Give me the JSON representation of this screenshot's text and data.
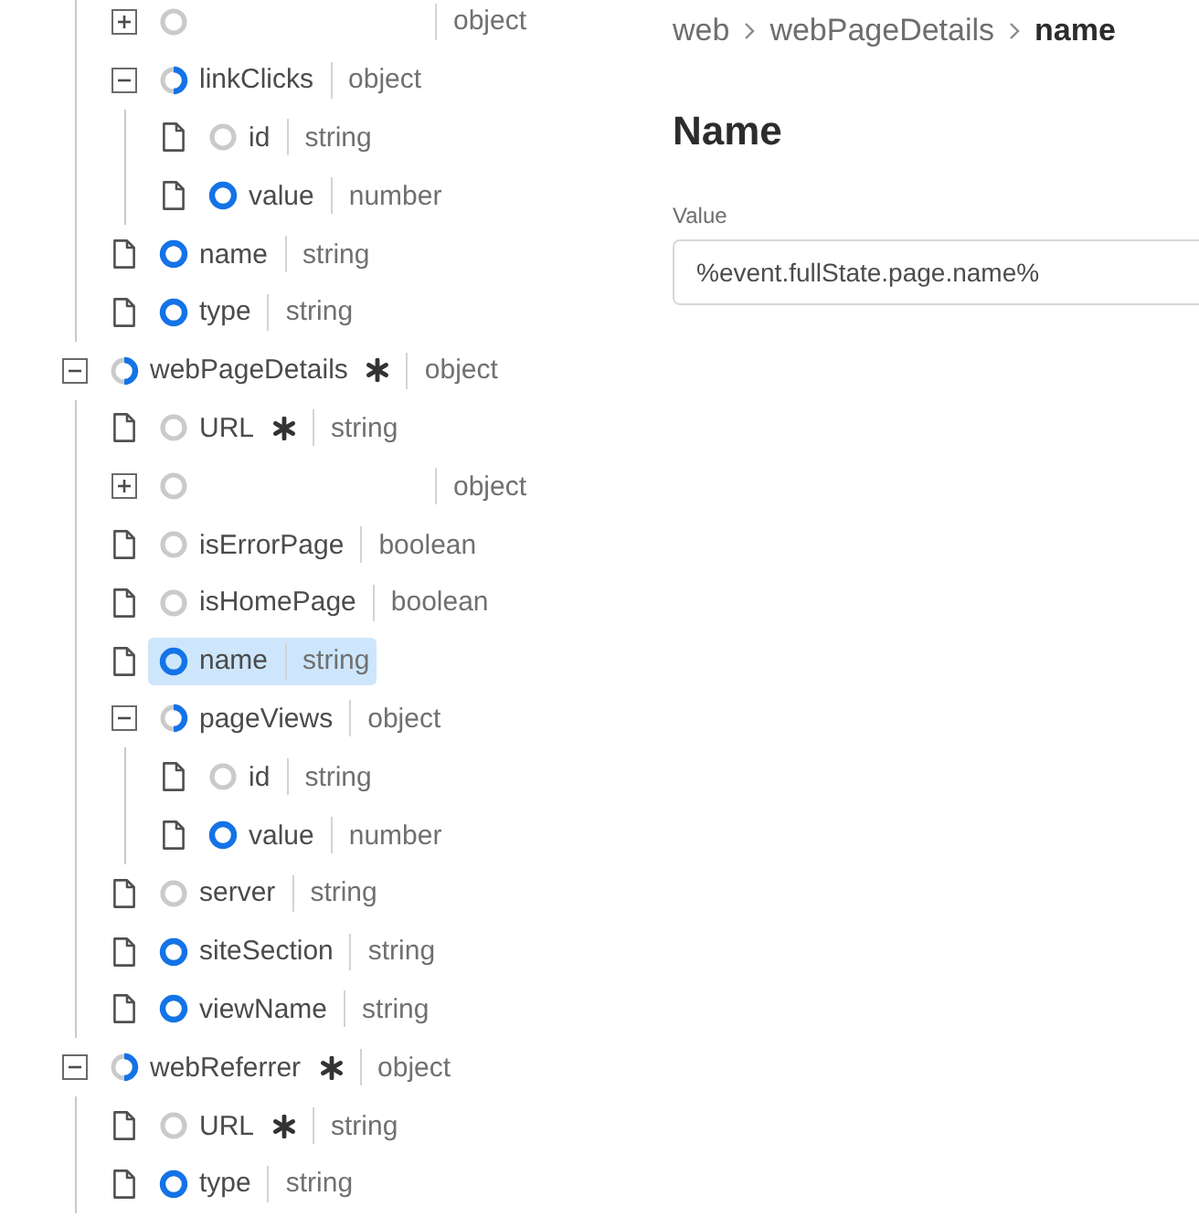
{
  "tree_top_children": [
    {
      "kind": "object",
      "mapped": false,
      "partly_mapped": false,
      "type": "object",
      "required": false,
      "expanded": false,
      "selected": false
    },
    {
      "kind": "object",
      "label": "linkClicks",
      "mapped": false,
      "partly_mapped": true,
      "type": "object",
      "required": false,
      "expanded": true,
      "selected": false,
      "children": [
        {
          "kind": "leaf",
          "label": "id",
          "mapped": false,
          "partly_mapped": false,
          "type": "string",
          "required": false,
          "selected": false
        },
        {
          "kind": "leaf",
          "label": "value",
          "mapped": true,
          "partly_mapped": false,
          "type": "number",
          "required": false,
          "selected": false
        }
      ]
    },
    {
      "kind": "leaf",
      "label": "name",
      "mapped": true,
      "partly_mapped": false,
      "type": "string",
      "required": false,
      "selected": false
    },
    {
      "kind": "leaf",
      "label": "type",
      "mapped": true,
      "partly_mapped": false,
      "type": "string",
      "required": false,
      "selected": false
    }
  ],
  "tree": [
    {
      "kind": "object",
      "label": "webPageDetails",
      "mapped": false,
      "partly_mapped": true,
      "type": "object",
      "required": true,
      "expanded": true,
      "selected": false,
      "children": [
        {
          "kind": "leaf",
          "label": "URL",
          "mapped": false,
          "partly_mapped": false,
          "type": "string",
          "required": true,
          "selected": false
        },
        {
          "kind": "object",
          "mapped": false,
          "partly_mapped": false,
          "type": "object",
          "required": false,
          "expanded": false,
          "selected": false
        },
        {
          "kind": "leaf",
          "label": "isErrorPage",
          "mapped": false,
          "partly_mapped": false,
          "type": "boolean",
          "required": false,
          "selected": false
        },
        {
          "kind": "leaf",
          "label": "isHomePage",
          "mapped": false,
          "partly_mapped": false,
          "type": "boolean",
          "required": false,
          "selected": false
        },
        {
          "kind": "leaf",
          "label": "name",
          "mapped": true,
          "partly_mapped": false,
          "type": "string",
          "required": false,
          "selected": true
        },
        {
          "kind": "object",
          "label": "pageViews",
          "mapped": false,
          "partly_mapped": true,
          "type": "object",
          "required": false,
          "expanded": true,
          "selected": false,
          "children": [
            {
              "kind": "leaf",
              "label": "id",
              "mapped": false,
              "partly_mapped": false,
              "type": "string",
              "required": false,
              "selected": false
            },
            {
              "kind": "leaf",
              "label": "value",
              "mapped": true,
              "partly_mapped": false,
              "type": "number",
              "required": false,
              "selected": false
            }
          ]
        },
        {
          "kind": "leaf",
          "label": "server",
          "mapped": false,
          "partly_mapped": false,
          "type": "string",
          "required": false,
          "selected": false
        },
        {
          "kind": "leaf",
          "label": "siteSection",
          "mapped": true,
          "partly_mapped": false,
          "type": "string",
          "required": false,
          "selected": false
        },
        {
          "kind": "leaf",
          "label": "viewName",
          "mapped": true,
          "partly_mapped": false,
          "type": "string",
          "required": false,
          "selected": false
        }
      ]
    },
    {
      "kind": "object",
      "label": "webReferrer",
      "mapped": false,
      "partly_mapped": true,
      "type": "object",
      "required": true,
      "expanded": true,
      "selected": false,
      "children": [
        {
          "kind": "leaf",
          "label": "URL",
          "mapped": false,
          "partly_mapped": false,
          "type": "string",
          "required": true,
          "selected": false
        },
        {
          "kind": "leaf",
          "label": "type",
          "mapped": true,
          "partly_mapped": false,
          "type": "string",
          "required": false,
          "selected": false
        }
      ]
    }
  ],
  "breadcrumb": [
    {
      "label": "web",
      "current": false
    },
    {
      "label": "webPageDetails",
      "current": false
    },
    {
      "label": "name",
      "current": true
    }
  ],
  "detail": {
    "title": "Name",
    "field": {
      "label": "Value",
      "value": "%event.fullState.page.name%"
    }
  }
}
